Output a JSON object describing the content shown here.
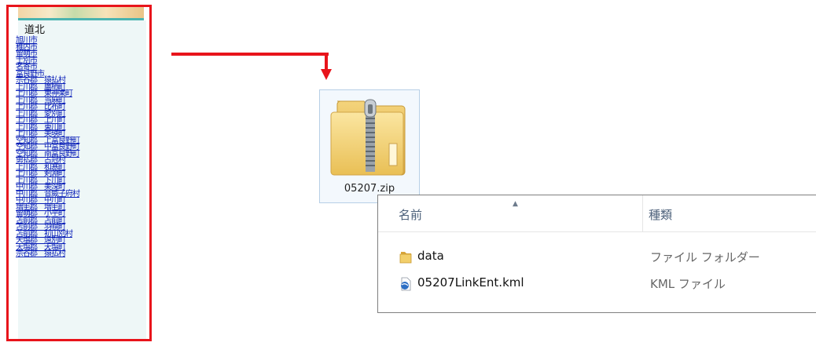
{
  "region_list": {
    "title": "道北",
    "items": [
      "旭川市",
      "稚内市",
      "留萌市",
      "士別市",
      "名寄市",
      "富良野市",
      "宗谷郡　猿払村",
      "上川郡　鷹栖町",
      "上川郡　東神楽町",
      "上川郡　当麻町",
      "上川郡　比布町",
      "上川郡　愛別町",
      "上川郡　上川町",
      "上川郡　東川町",
      "上川郡　美瑛町",
      "空知郡　上富良野町",
      "空知郡　中富良野町",
      "空知郡　南富良野町",
      "勇払郡　占冠村",
      "上川郡　和寒町",
      "上川郡　剣淵町",
      "上川郡　下川町",
      "中川郡　美深町",
      "中川郡　音威子府村",
      "中川郡　中川町",
      "増毛郡　増毛町",
      "留萌郡　小平町",
      "苫前郡　苫前町",
      "苫前郡　羽幌町",
      "苫前郡　初山別村",
      "天塩郡　遠別町",
      "天塩郡　天塩町",
      "宗谷郡　猿払村"
    ]
  },
  "zip_file": {
    "label": "05207.zip"
  },
  "explorer": {
    "columns": {
      "name": "名前",
      "type": "種類"
    },
    "rows": [
      {
        "name": "data",
        "type": "ファイル フォルダー",
        "icon": "folder-icon"
      },
      {
        "name": "05207LinkEnt.kml",
        "type": "KML ファイル",
        "icon": "kml-file-icon"
      }
    ]
  },
  "colors": {
    "highlight": "#e8141b",
    "link": "#0b20b8",
    "header_text": "#4c607a"
  }
}
